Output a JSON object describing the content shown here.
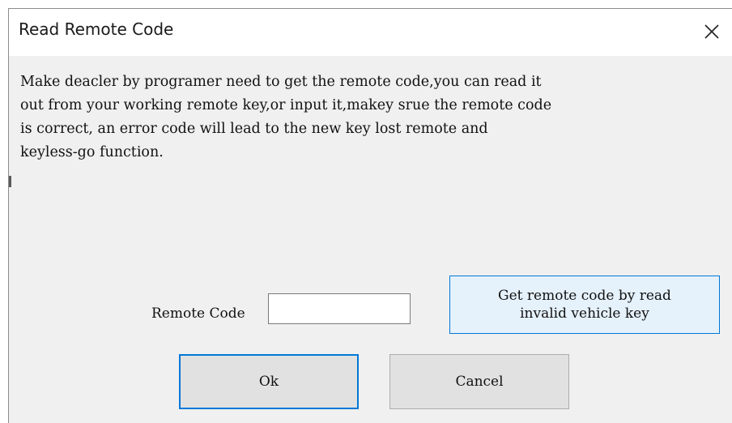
{
  "window": {
    "title": "Read Remote Code",
    "close_icon": "close-icon"
  },
  "message": "Make deacler by programer need to get the remote code,you can read it\nout from your working remote key,or input it,makey srue the remote code\nis correct, an error code will lead to the new key lost remote and\nkeyless-go function.",
  "remote_code": {
    "label": "Remote Code",
    "value": ""
  },
  "buttons": {
    "read_key": "Get remote code by read\ninvalid vehicle key",
    "ok": "Ok",
    "cancel": "Cancel"
  },
  "colors": {
    "accent": "#0078d7",
    "button_face": "#e1e1e1",
    "hover_face": "#e5f1fb",
    "dialog_bg": "#f0f0f0"
  }
}
